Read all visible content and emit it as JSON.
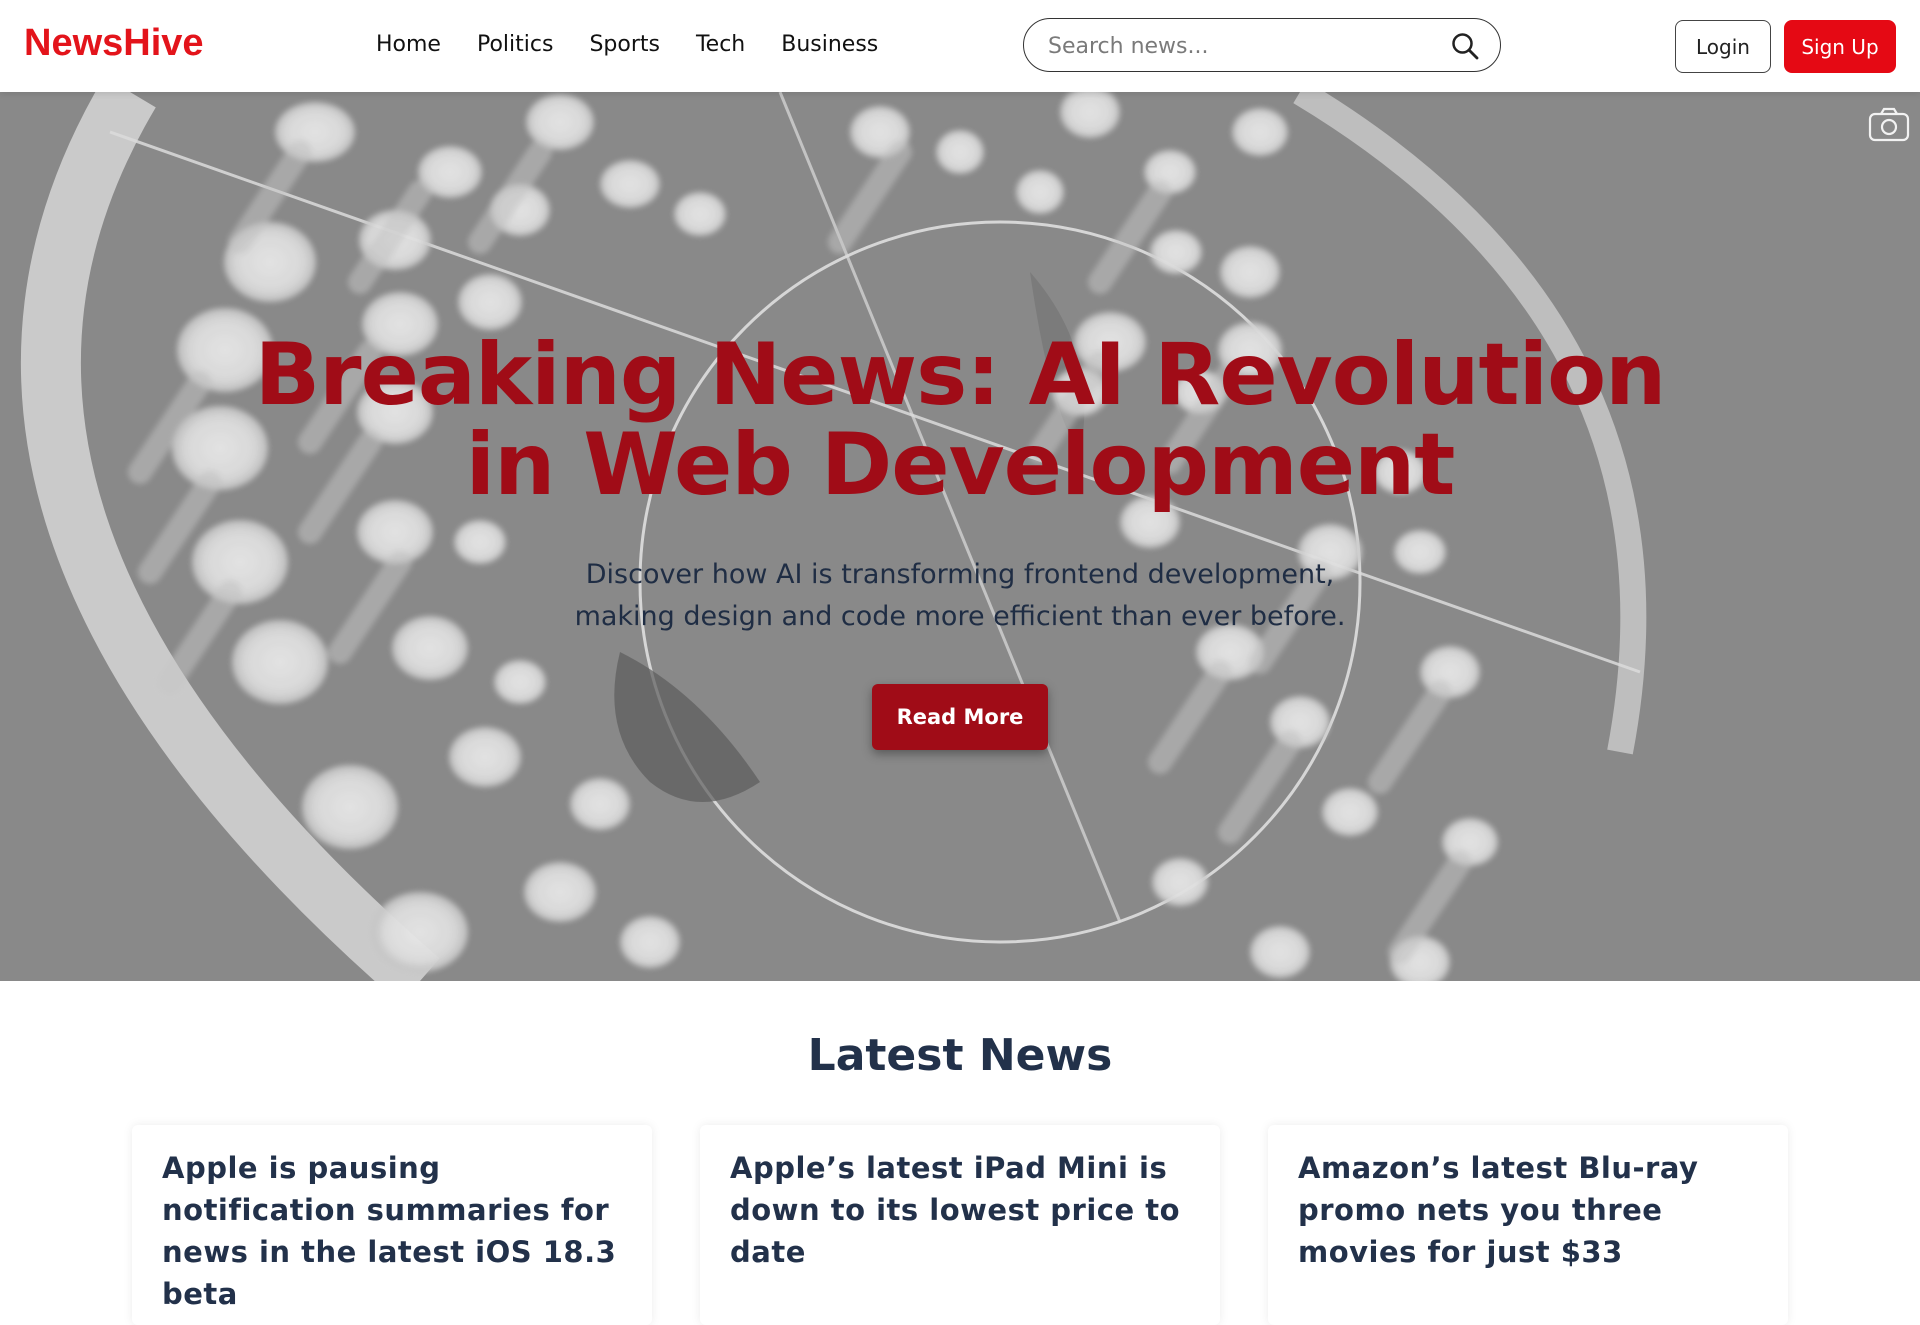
{
  "brand": {
    "name": "NewsHive",
    "color": "#e3141b"
  },
  "nav": {
    "items": [
      {
        "label": "Home"
      },
      {
        "label": "Politics"
      },
      {
        "label": "Sports"
      },
      {
        "label": "Tech"
      },
      {
        "label": "Business"
      }
    ]
  },
  "search": {
    "placeholder": "Search news...",
    "value": "",
    "icon": "search-icon"
  },
  "auth": {
    "login_label": "Login",
    "signup_label": "Sign Up",
    "signup_color": "#e50914"
  },
  "hero": {
    "title_line1": "Breaking News: AI Revolution",
    "title_line2": "in Web Development",
    "desc_line1": "Discover how AI is transforming frontend development,",
    "desc_line2": "making design and code more efficient than ever before.",
    "cta_label": "Read More",
    "accent": "#a00c17",
    "corner_icon": "camera-icon"
  },
  "latest": {
    "title": "Latest News",
    "cards": [
      {
        "title": "Apple is pausing notification summaries for news in the latest iOS 18.3 beta"
      },
      {
        "title": "Apple’s latest iPad Mini is down to its lowest price to date"
      },
      {
        "title": "Amazon’s latest Blu-ray promo nets you three movies for just $33"
      }
    ]
  }
}
